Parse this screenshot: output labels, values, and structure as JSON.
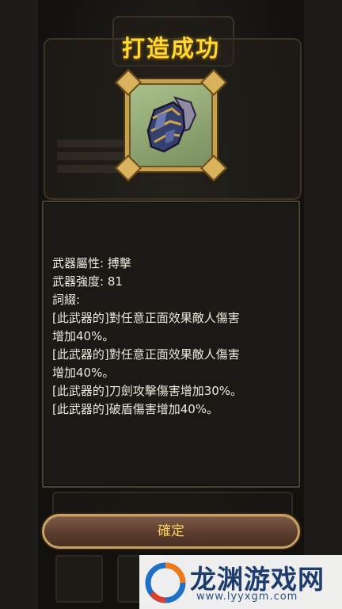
{
  "dialog": {
    "title": "打造成功",
    "confirm_label": "確定"
  },
  "item": {
    "icon": "gauntlet-icon",
    "frame_color": "#c7a14e",
    "background_color": "#9fb783"
  },
  "details": {
    "lines": [
      "武器屬性:  搏擊",
      "武器強度:  81",
      "詞綴:",
      "[此武器的]對任意正面效果敵人傷害",
      "增加40%。",
      "[此武器的]對任意正面效果敵人傷害",
      "增加40%。",
      "[此武器的]刀劍攻擊傷害增加30%。",
      "[此武器的]破盾傷害增加40%。"
    ]
  },
  "watermark": {
    "title": "龙渊游戏网",
    "url": "www.lyyxgm.com"
  },
  "colors": {
    "title": "#ffd833",
    "button_text": "#f5cf62",
    "panel_bg": "#1b1915",
    "text": "#ece8de"
  }
}
